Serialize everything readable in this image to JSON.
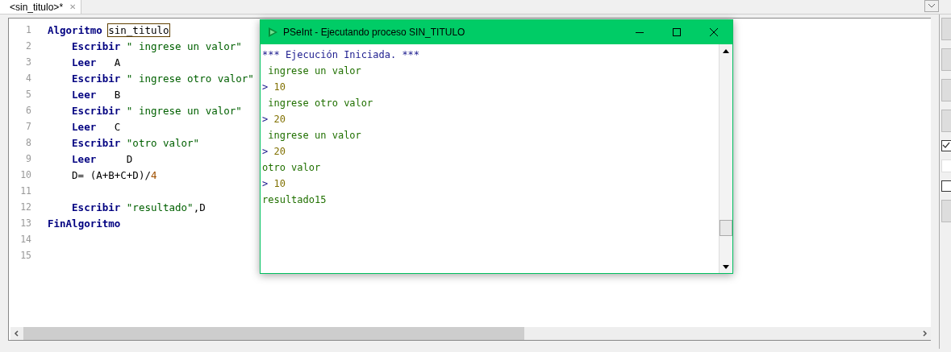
{
  "tab": {
    "title": "<sin_titulo>*",
    "close": "✕"
  },
  "editor": {
    "lines": [
      {
        "number": "1",
        "indented": false,
        "tokens": [
          {
            "kind": "keyword",
            "text": "Algoritmo"
          },
          {
            "kind": "boxed",
            "text": "sin_titulo"
          }
        ]
      },
      {
        "number": "2",
        "indented": true,
        "tokens": [
          {
            "kind": "keyword",
            "text": "Escribir"
          },
          {
            "kind": "string",
            "text": "\" ingrese un valor\""
          }
        ]
      },
      {
        "number": "3",
        "indented": true,
        "tokens": [
          {
            "kind": "keyword",
            "text": "Leer"
          },
          {
            "kind": "plain",
            "text": "   A"
          }
        ]
      },
      {
        "number": "4",
        "indented": true,
        "tokens": [
          {
            "kind": "keyword",
            "text": "Escribir"
          },
          {
            "kind": "string",
            "text": "\" ingrese otro valor\""
          }
        ]
      },
      {
        "number": "5",
        "indented": true,
        "tokens": [
          {
            "kind": "keyword",
            "text": "Leer"
          },
          {
            "kind": "plain",
            "text": "   B"
          }
        ]
      },
      {
        "number": "6",
        "indented": true,
        "tokens": [
          {
            "kind": "keyword",
            "text": "Escribir"
          },
          {
            "kind": "string",
            "text": "\" ingrese un valor\""
          }
        ]
      },
      {
        "number": "7",
        "indented": true,
        "tokens": [
          {
            "kind": "keyword",
            "text": "Leer"
          },
          {
            "kind": "plain",
            "text": "   C"
          }
        ]
      },
      {
        "number": "8",
        "indented": true,
        "tokens": [
          {
            "kind": "keyword",
            "text": "Escribir"
          },
          {
            "kind": "string",
            "text": "\"otro valor\""
          }
        ]
      },
      {
        "number": "9",
        "indented": true,
        "tokens": [
          {
            "kind": "keyword",
            "text": "Leer"
          },
          {
            "kind": "plain",
            "text": "     D"
          }
        ]
      },
      {
        "number": "10",
        "indented": true,
        "tokens": [
          {
            "kind": "plain",
            "text": "D= (A+B+C+D)/"
          },
          {
            "kind": "number",
            "text": "4"
          }
        ]
      },
      {
        "number": "11"
      },
      {
        "number": "12",
        "indented": true,
        "tokens": [
          {
            "kind": "keyword",
            "text": "Escribir"
          },
          {
            "kind": "string",
            "text": "\"resultado\""
          },
          {
            "kind": "plain",
            "text": ",D"
          }
        ]
      },
      {
        "number": "13",
        "indented": false,
        "tokens": [
          {
            "kind": "keyword",
            "text": "FinAlgoritmo"
          }
        ]
      },
      {
        "number": "14"
      },
      {
        "number": "15"
      }
    ]
  },
  "side_panel": {
    "controls": [
      {
        "kind": "button"
      },
      {
        "kind": "button"
      },
      {
        "kind": "button"
      },
      {
        "kind": "button"
      },
      {
        "kind": "checkbox",
        "checked": true
      },
      {
        "kind": "field"
      },
      {
        "kind": "checkbox",
        "checked": false
      },
      {
        "kind": "button"
      }
    ]
  },
  "console_window": {
    "title": "PSeInt - Ejecutando proceso SIN_TITULO",
    "lines": [
      {
        "kind": "banner",
        "text": "*** Ejecución Iniciada. ***"
      },
      {
        "kind": "output",
        "text": " ingrese un valor"
      },
      {
        "kind": "input",
        "prompt": ">",
        "text": "10"
      },
      {
        "kind": "output",
        "text": " ingrese otro valor"
      },
      {
        "kind": "input",
        "prompt": ">",
        "text": "20"
      },
      {
        "kind": "output",
        "text": " ingrese un valor"
      },
      {
        "kind": "input",
        "prompt": ">",
        "text": "20"
      },
      {
        "kind": "output",
        "text": "otro valor"
      },
      {
        "kind": "input",
        "prompt": ">",
        "text": "10"
      },
      {
        "kind": "output",
        "text": "resultado15"
      }
    ]
  }
}
